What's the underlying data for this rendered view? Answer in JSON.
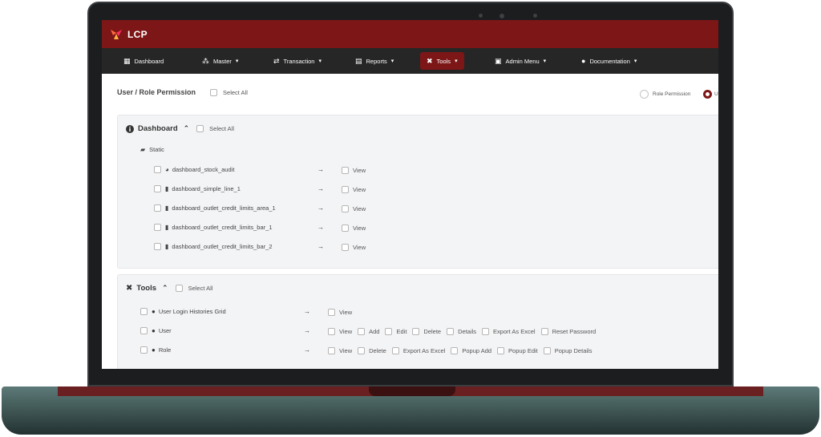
{
  "app": {
    "brand": "LCP"
  },
  "nav": [
    {
      "label": "Dashboard",
      "icon": "grid-icon",
      "glyph": "▦",
      "chevron": false
    },
    {
      "label": "Master",
      "icon": "network-icon",
      "glyph": "⁂",
      "chevron": true
    },
    {
      "label": "Transaction",
      "icon": "arrows-icon",
      "glyph": "⇄",
      "chevron": true
    },
    {
      "label": "Reports",
      "icon": "table-icon",
      "glyph": "▤",
      "chevron": true
    },
    {
      "label": "Tools",
      "icon": "tools-icon",
      "glyph": "✖",
      "chevron": true,
      "active": true
    },
    {
      "label": "Admin Menu",
      "icon": "menu-icon",
      "glyph": "▣",
      "chevron": true
    },
    {
      "label": "Documentation",
      "icon": "info-icon",
      "glyph": "●",
      "chevron": true
    }
  ],
  "page": {
    "title": "User / Role Permission",
    "select_all": "Select All",
    "radio_role": "Role Permission",
    "radio_user": "U"
  },
  "dashboard": {
    "title": "Dashboard",
    "select_all": "Select All",
    "group": "Static",
    "items": [
      {
        "label": "dashboard_stock_audit",
        "perm": "View"
      },
      {
        "label": "dashboard_simple_line_1",
        "perm": "View"
      },
      {
        "label": "dashboard_outlet_credit_limits_area_1",
        "perm": "View"
      },
      {
        "label": "dashboard_outlet_credit_limits_bar_1",
        "perm": "View"
      },
      {
        "label": "dashboard_outlet_credit_limits_bar_2",
        "perm": "View"
      }
    ]
  },
  "tools": {
    "title": "Tools",
    "select_all": "Select All",
    "items": [
      {
        "label": "User Login Histories Grid",
        "perms": [
          "View"
        ]
      },
      {
        "label": "User",
        "perms": [
          "View",
          "Add",
          "Edit",
          "Delete",
          "Details",
          "Export As Excel",
          "Reset Password"
        ]
      },
      {
        "label": "Role",
        "perms": [
          "View",
          "Delete",
          "Export As Excel",
          "Popup Add",
          "Popup Edit",
          "Popup Details"
        ]
      }
    ]
  },
  "colors": {
    "brand": "#7d1616",
    "nav_bg": "#262626",
    "panel_bg": "#f3f4f6"
  }
}
